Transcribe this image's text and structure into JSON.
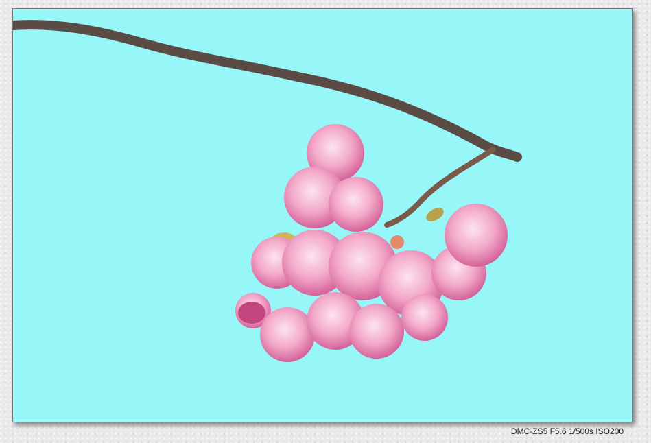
{
  "colors": {
    "sky": "#97f6f8",
    "branch": "#5a4c45",
    "petal": "#f3a9c9",
    "petal_dark": "#d4629a"
  },
  "caption": "DMC-ZS5 F5.6 1/500s ISO200"
}
